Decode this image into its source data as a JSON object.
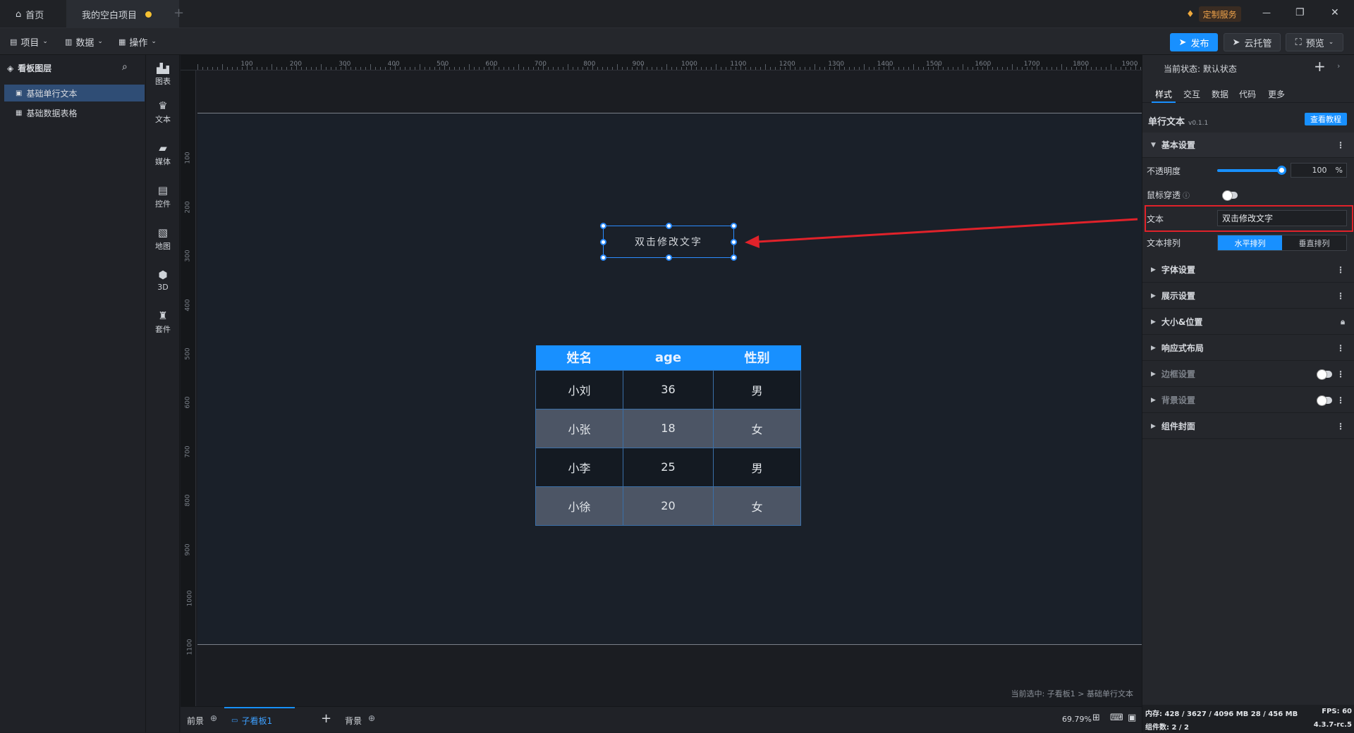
{
  "titlebar": {
    "home_tab": "首页",
    "project_tab": "我的空白项目",
    "custom_service": "定制服务",
    "min": "—",
    "restore": "❐",
    "close": "✕"
  },
  "menubar": {
    "project": "项目",
    "data": "数据",
    "operate": "操作",
    "publish": "发布",
    "cloud": "云托管",
    "preview": "预览"
  },
  "layers": {
    "title": "看板图层",
    "items": [
      "基础单行文本",
      "基础数据表格"
    ]
  },
  "toolbox": [
    "图表",
    "文本",
    "媒体",
    "控件",
    "地图",
    "3D",
    "套件"
  ],
  "rulers": {
    "top": [
      "100",
      "200",
      "300",
      "400",
      "500",
      "600",
      "700",
      "800",
      "900",
      "1000",
      "1100",
      "1200",
      "1300",
      "1400",
      "1500",
      "1600",
      "1700",
      "1800",
      "1900"
    ],
    "left": [
      "100",
      "200",
      "300",
      "400",
      "500",
      "600",
      "700",
      "800",
      "900",
      "1000",
      "1100"
    ]
  },
  "canvas": {
    "text_element": "双击修改文字",
    "table": {
      "headers": [
        "姓名",
        "age",
        "性别"
      ],
      "rows": [
        [
          "小刘",
          "36",
          "男"
        ],
        [
          "小张",
          "18",
          "女"
        ],
        [
          "小李",
          "25",
          "男"
        ],
        [
          "小徐",
          "20",
          "女"
        ]
      ]
    },
    "selection_path": "当前选中: 子看板1 > 基础单行文本"
  },
  "bottombar": {
    "foreground": "前景",
    "subboard": "子看板1",
    "background": "背景",
    "zoom": "69.79%"
  },
  "rightpanel": {
    "state": "当前状态: 默认状态",
    "tabs": [
      "样式",
      "交互",
      "数据",
      "代码",
      "更多"
    ],
    "component": "单行文本",
    "version": "v0.1.1",
    "tutorial": "查看教程",
    "basic": "基本设置",
    "opacity_label": "不透明度",
    "opacity_value": "100",
    "opacity_unit": "%",
    "opacity_fraction": 1.0,
    "mouse_pass": "鼠标穿透",
    "text_label": "文本",
    "text_value": "双击修改文字",
    "layout_label": "文本排列",
    "layout_h": "水平排列",
    "layout_v": "垂直排列",
    "sections": [
      "字体设置",
      "展示设置",
      "大小&位置",
      "响应式布局",
      "边框设置",
      "背景设置",
      "组件封面"
    ],
    "status_mem": "内存: 428 / 3627 / 4096 MB  28 / 456 MB",
    "status_fps": "FPS: 60",
    "status_count": "组件数: 2 / 2",
    "status_version": "4.3.7-rc.5"
  },
  "colors": {
    "accent": "#1890ff",
    "highlight": "#e0222a"
  }
}
